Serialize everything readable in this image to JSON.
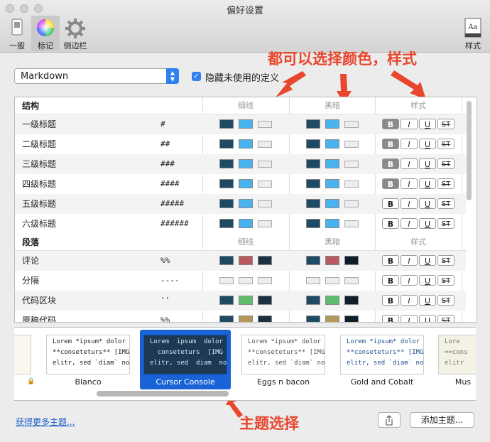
{
  "window": {
    "title": "偏好设置"
  },
  "toolbar": {
    "general": "一般",
    "markup": "标记",
    "sidebar": "侧边栏",
    "theme": "样式",
    "theme_icon_text": "Aa"
  },
  "language_select": {
    "value": "Markdown"
  },
  "hide_unused": {
    "label": "隐藏未使用的定义",
    "checked": true
  },
  "annotations": {
    "top": "都可以选择颜色，样式",
    "bottom": "主题选择"
  },
  "table": {
    "columns": {
      "thin": "细线",
      "dark": "黑暗",
      "style": "样式"
    },
    "groups": [
      {
        "title": "结构",
        "rows": [
          {
            "name": "一级标题",
            "symbol": "#",
            "thin": [
              "#1f4a63",
              "#47b3ef",
              "empty"
            ],
            "dark": [
              "#1f4a63",
              "#47b3ef",
              "empty"
            ],
            "style": {
              "b": true
            }
          },
          {
            "name": "二级标题",
            "symbol": "##",
            "thin": [
              "#1f4a63",
              "#47b3ef",
              "empty"
            ],
            "dark": [
              "#1f4a63",
              "#47b3ef",
              "empty"
            ],
            "style": {
              "b": true
            }
          },
          {
            "name": "三级标题",
            "symbol": "###",
            "thin": [
              "#1f4a63",
              "#47b3ef",
              "empty"
            ],
            "dark": [
              "#1f4a63",
              "#47b3ef",
              "empty"
            ],
            "style": {
              "b": true
            }
          },
          {
            "name": "四级标题",
            "symbol": "####",
            "thin": [
              "#1f4a63",
              "#47b3ef",
              "empty"
            ],
            "dark": [
              "#1f4a63",
              "#47b3ef",
              "empty"
            ],
            "style": {
              "b": true
            }
          },
          {
            "name": "五级标题",
            "symbol": "#####",
            "thin": [
              "#1f4a63",
              "#47b3ef",
              "empty"
            ],
            "dark": [
              "#1f4a63",
              "#47b3ef",
              "empty"
            ],
            "style": {
              "b": false
            }
          },
          {
            "name": "六级标题",
            "symbol": "######",
            "thin": [
              "#1f4a63",
              "#47b3ef",
              "empty"
            ],
            "dark": [
              "#1f4a63",
              "#47b3ef",
              "empty"
            ],
            "style": {
              "b": false
            }
          }
        ]
      },
      {
        "title": "段落",
        "rows": [
          {
            "name": "评论",
            "symbol": "%%",
            "thin": [
              "#1f4a63",
              "#b85a5f",
              "#1b3140"
            ],
            "dark": [
              "#1f4a63",
              "#b85a5f",
              "#0f1e28"
            ],
            "style": {
              "b": false
            }
          },
          {
            "name": "分隔",
            "symbol": "----",
            "thin": [
              "empty",
              "empty",
              "empty"
            ],
            "dark": [
              "empty",
              "empty",
              "empty"
            ],
            "style": {
              "b": false
            }
          },
          {
            "name": "代码区块",
            "symbol": "''",
            "thin": [
              "#1f4a63",
              "#5dbd6d",
              "#1b3140"
            ],
            "dark": [
              "#1f4a63",
              "#5dbd6d",
              "#0f1e28"
            ],
            "style": {
              "b": false
            }
          },
          {
            "name": "原稿代码",
            "symbol": "%%",
            "thin": [
              "#1f4a63",
              "#b39a5a",
              "#1b3140"
            ],
            "dark": [
              "#1f4a63",
              "#b39a5a",
              "#0f1e28"
            ],
            "style": {
              "b": false
            }
          }
        ]
      }
    ],
    "style_buttons": [
      "B",
      "I",
      "U",
      "ST"
    ]
  },
  "themes": [
    {
      "name": "",
      "lines": [
        "n",
        "",
        "no"
      ]
    },
    {
      "name": "Blanco",
      "lines": [
        "Lorem *ipsum* dolor",
        "**conseteturs** [IMG",
        "elitr, sed `diam` no"
      ]
    },
    {
      "name": "Cursor Console",
      "lines": [
        "Lorem  ipsum  dolor",
        "  conseteturs  [IMG",
        "elitr, sed  diam  no"
      ]
    },
    {
      "name": "Eggs n bacon",
      "lines": [
        "Lorem *ipsum* dolor",
        "**conseteturs** [IMG",
        "elitr, sed `diam` no"
      ]
    },
    {
      "name": "Gold and Cobalt",
      "lines": [
        "Lorem *ipsum* dolor",
        "**conseteturs** [IMG",
        "elitr, sed `diam` no"
      ]
    },
    {
      "name": "Mus",
      "lines": [
        "Lore",
        "==cons",
        "elitr"
      ]
    }
  ],
  "footer": {
    "more_themes": "获得更多主题...",
    "add_theme": "添加主题..."
  }
}
